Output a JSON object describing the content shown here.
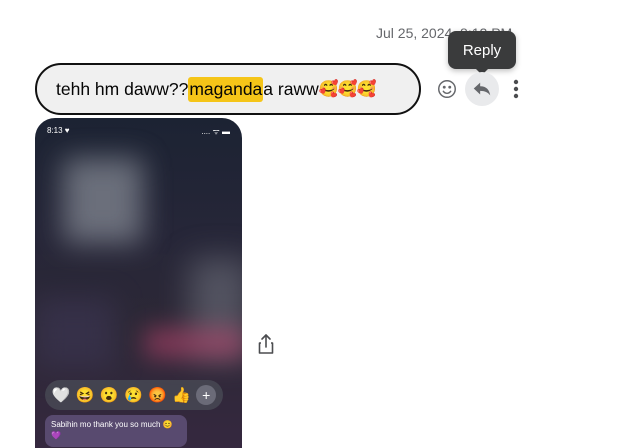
{
  "message": {
    "timestamp": "Jul 25, 2024, 8:12 PM",
    "text_before": "tehh hm daww?? ",
    "text_highlight": "maganda",
    "text_after": "a raww",
    "emoji": "🥰🥰🥰"
  },
  "tooltip": {
    "label": "Reply"
  },
  "actions": {
    "react_icon": "smile-icon",
    "reply_icon": "reply-icon",
    "more_icon": "more-vertical-icon"
  },
  "attachment": {
    "status_time": "8:13 ♥",
    "status_right": ".... ᯤ ▬",
    "reactions": [
      "🤍",
      "😆",
      "😮",
      "😢",
      "😡",
      "👍"
    ],
    "reaction_add": "+",
    "phone_message": "Sabihin mo thank you so much 😊 💜",
    "share_icon": "share-icon"
  },
  "colors": {
    "highlight": "#f5c518",
    "bubble_bg": "#f0f0f0",
    "tooltip_bg": "#3a3b3c"
  }
}
